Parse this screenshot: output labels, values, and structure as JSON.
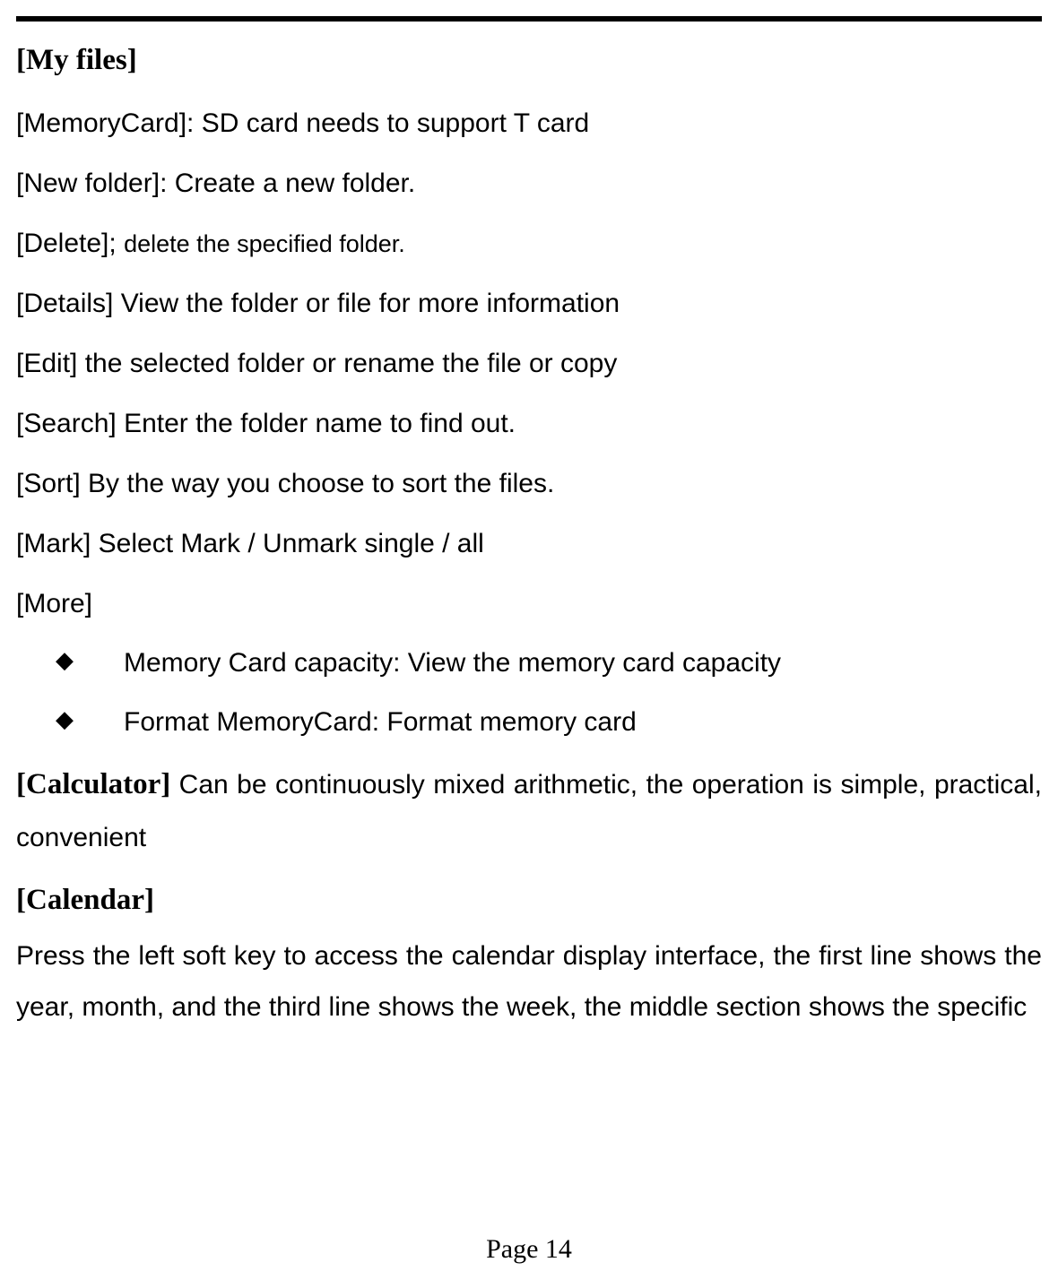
{
  "sections": {
    "myfiles": {
      "heading": "[My files]",
      "items": {
        "memorycard": {
          "label": "[MemoryCard]: ",
          "desc": "SD card needs to support T card"
        },
        "newfolder": {
          "label": "[New folder]: ",
          "desc": "Create a new folder."
        },
        "delete": {
          "label": "[Delete]; ",
          "desc": "delete the specified folder."
        },
        "details": {
          "label": "[Details] ",
          "desc": "View the folder or file for more information"
        },
        "edit": {
          "label": "[Edit] ",
          "desc": "the selected folder or rename the file or copy"
        },
        "search": {
          "label": "[Search] ",
          "desc": "Enter the folder name to find out."
        },
        "sort": {
          "label": "[Sort] ",
          "desc": "By the way you choose to sort the files."
        },
        "mark": {
          "label": "[Mark] ",
          "desc": "Select Mark / Unmark single / all"
        },
        "more": {
          "label": "[More]"
        }
      },
      "more_bullets": {
        "b0": "Memory Card capacity: View the memory card capacity",
        "b1": "Format MemoryCard: Format memory card"
      }
    },
    "calculator": {
      "heading": "[Calculator] ",
      "desc": "Can be continuously mixed arithmetic, the operation is simple, practical, convenient"
    },
    "calendar": {
      "heading": "[Calendar]",
      "body": "Press the left soft key to access the calendar display interface, the first line shows the year, month, and the third line shows the week, the middle section shows the specific"
    }
  },
  "bullet_glyph": "◆",
  "page_label": "Page 14"
}
